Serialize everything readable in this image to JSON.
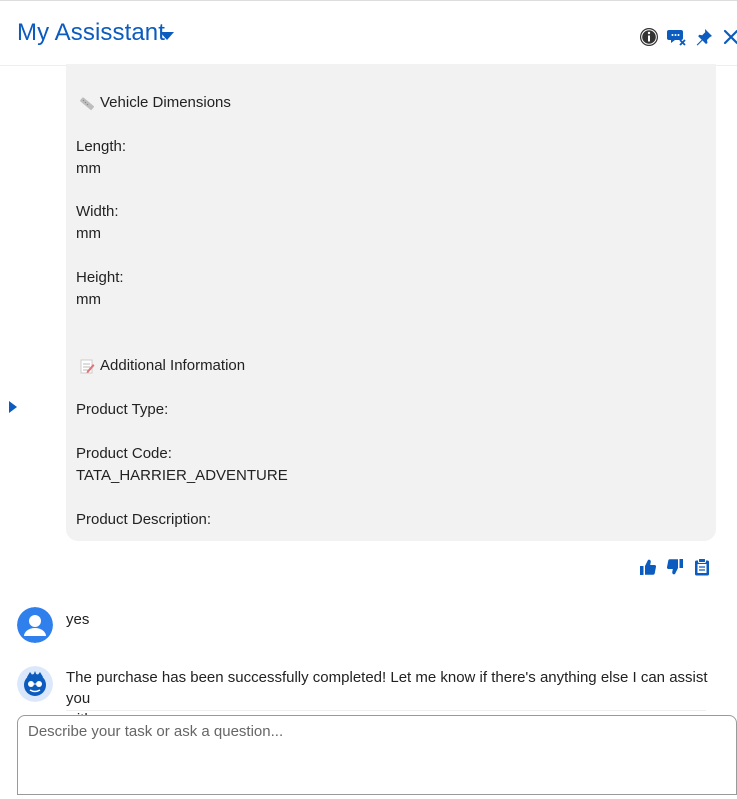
{
  "header": {
    "title": "My Assisstant",
    "icons": [
      "info-icon",
      "chat-clear-icon",
      "pin-icon",
      "close-icon"
    ]
  },
  "product_card": {
    "dimensions_heading": "Vehicle Dimensions",
    "length_label": "Length:",
    "length_unit": "mm",
    "width_label": "Width:",
    "width_unit": "mm",
    "height_label": "Height:",
    "height_unit": "mm",
    "additional_heading": "Additional Information",
    "product_type_label": "Product Type:",
    "product_code_label": "Product Code:",
    "product_code_value": "TATA_HARRIER_ADVENTURE",
    "product_description_label": "Product Description:"
  },
  "feedback_icons": [
    "thumbs-up-icon",
    "thumbs-down-icon",
    "clipboard-icon"
  ],
  "conversation": {
    "user_message": "yes",
    "assistant_message_line1": "The purchase has been successfully completed! Let me know if there's anything else I can assist you",
    "assistant_message_line2": "with."
  },
  "composer": {
    "placeholder": "Describe your task or ask a question..."
  },
  "colors": {
    "brand_blue": "#0b5cbe",
    "bubble_gray": "#f2f2f2",
    "avatar_blue": "#2f80ed"
  }
}
